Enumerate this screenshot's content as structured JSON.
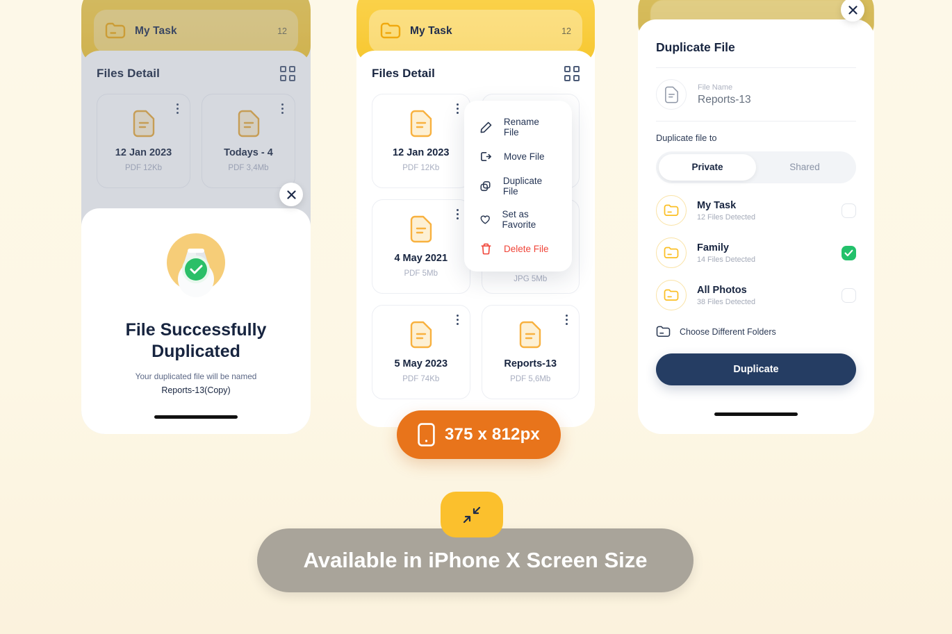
{
  "page": {
    "background_color": "#fdf6e3",
    "banner": {
      "text": "Available in iPhone X Screen Size",
      "icon": "collapse-arrows-icon"
    },
    "size_badge": {
      "text": "375 x 812px",
      "icon": "mobile-phone-icon",
      "color": "#e8741b"
    }
  },
  "phone1": {
    "header": {
      "folder_icon": "folder-icon",
      "title": "My Task",
      "count": "12"
    },
    "sheet": {
      "title": "Files Detail",
      "view_icon": "grid-view-icon"
    },
    "files": [
      {
        "name": "12 Jan 2023",
        "meta": "PDF 12Kb",
        "icon": "document-icon"
      },
      {
        "name": "Todays - 4",
        "meta": "PDF 3,4Mb",
        "icon": "document-icon"
      }
    ],
    "close_icon": "close-icon",
    "success": {
      "icon": "success-check-icon",
      "title_line1": "File Successfully",
      "title_line2": "Duplicated",
      "subtitle": "Your duplicated file will be named",
      "filename": "Reports-13(Copy)"
    }
  },
  "phone2": {
    "header": {
      "folder_icon": "folder-icon",
      "title": "My Task",
      "count": "12"
    },
    "sheet": {
      "title": "Files Detail",
      "view_icon": "grid-view-icon"
    },
    "files": [
      {
        "name": "12 Jan 2023",
        "meta": "PDF 12Kb",
        "icon": "document-icon"
      },
      {
        "name": "",
        "meta": "",
        "icon": "document-icon"
      },
      {
        "name": "4 May 2021",
        "meta": "PDF 5Mb",
        "icon": "document-icon"
      },
      {
        "name": "",
        "meta": "JPG 5Mb",
        "icon": "document-icon"
      },
      {
        "name": "5 May 2023",
        "meta": "PDF 74Kb",
        "icon": "document-icon"
      },
      {
        "name": "Reports-13",
        "meta": "PDF 5,6Mb",
        "icon": "document-icon"
      }
    ],
    "context_menu": [
      {
        "label": "Rename File",
        "icon": "pencil-icon",
        "danger": false
      },
      {
        "label": "Move File",
        "icon": "move-arrow-icon",
        "danger": false
      },
      {
        "label": "Duplicate File",
        "icon": "duplicate-icon",
        "danger": false
      },
      {
        "label": "Set as Favorite",
        "icon": "heart-icon",
        "danger": false
      },
      {
        "label": "Delete File",
        "icon": "trash-icon",
        "danger": true
      }
    ]
  },
  "phone3": {
    "close_icon": "close-icon",
    "title": "Duplicate File",
    "file": {
      "icon": "document-icon",
      "label": "File Name",
      "value": "Reports-13"
    },
    "duplicate_to_label": "Duplicate file to",
    "segments": [
      {
        "label": "Private",
        "selected": true
      },
      {
        "label": "Shared",
        "selected": false
      }
    ],
    "folders": [
      {
        "name": "My Task",
        "meta": "12 Files Detected",
        "checked": false,
        "icon": "folder-icon"
      },
      {
        "name": "Family",
        "meta": "14 Files Detected",
        "checked": true,
        "icon": "folder-icon"
      },
      {
        "name": "All Photos",
        "meta": "38 Files Detected",
        "checked": false,
        "icon": "folder-icon"
      }
    ],
    "choose_different": {
      "label": "Choose Different Folders",
      "icon": "folder-outline-icon"
    },
    "submit": {
      "label": "Duplicate",
      "color": "#253d63"
    }
  }
}
